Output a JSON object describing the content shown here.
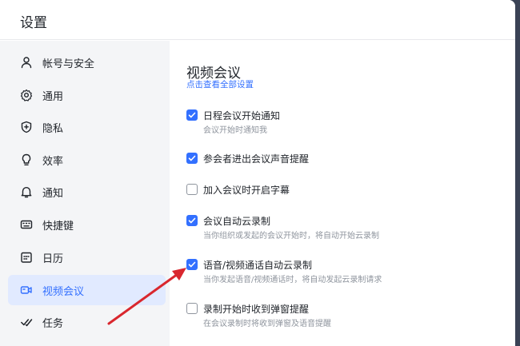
{
  "window": {
    "title": "设置"
  },
  "sidebar": {
    "items": [
      {
        "label": "帐号与安全",
        "icon": "user-icon",
        "active": false
      },
      {
        "label": "通用",
        "icon": "gear-icon",
        "active": false
      },
      {
        "label": "隐私",
        "icon": "shield-icon",
        "active": false
      },
      {
        "label": "效率",
        "icon": "lightbulb-icon",
        "active": false
      },
      {
        "label": "通知",
        "icon": "bell-icon",
        "active": false
      },
      {
        "label": "快捷键",
        "icon": "keyboard-icon",
        "active": false
      },
      {
        "label": "日历",
        "icon": "calendar-icon",
        "active": false
      },
      {
        "label": "视频会议",
        "icon": "video-camera-icon",
        "active": true
      },
      {
        "label": "任务",
        "icon": "task-check-icon",
        "active": false
      }
    ]
  },
  "main": {
    "section_title": "视频会议",
    "view_all_link": "点击查看全部设置",
    "options": [
      {
        "label": "日程会议开始通知",
        "description": "会议开始时通知我",
        "checked": true
      },
      {
        "label": "参会者进出会议声音提醒",
        "description": "",
        "checked": true
      },
      {
        "label": "加入会议时开启字幕",
        "description": "",
        "checked": false
      },
      {
        "label": "会议自动云录制",
        "description": "当你组织或发起的会议开始时，将自动开始云录制",
        "checked": true
      },
      {
        "label": "语音/视频通话自动云录制",
        "description": "当你发起语音/视频通话时，将自动发起云录制请求",
        "checked": true
      },
      {
        "label": "录制开始时收到弹窗提醒",
        "description": "在会议录制时将收到弹窗及语音提醒",
        "checked": false
      }
    ]
  },
  "colors": {
    "accent": "#3370ff",
    "active_bg": "#e1eaff",
    "annotation_arrow": "#d9272e",
    "desktop_bg": "#3a4255"
  }
}
